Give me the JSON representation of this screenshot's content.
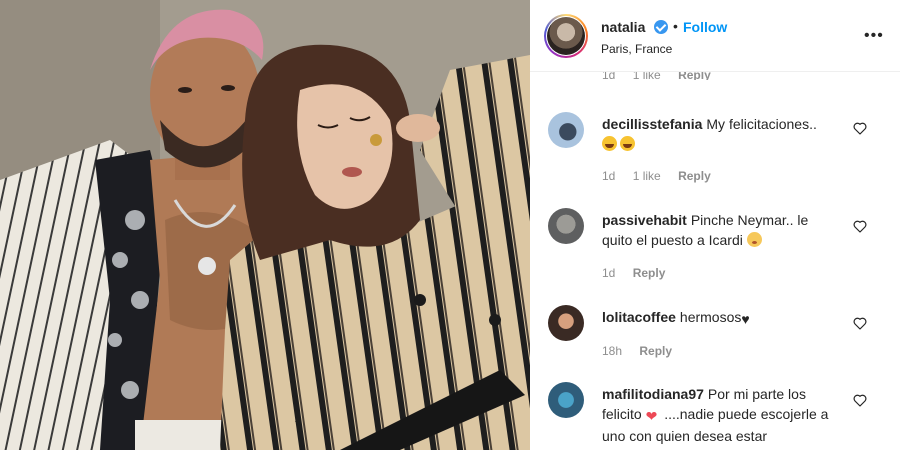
{
  "post": {
    "username": "natalia",
    "follow_label": "Follow",
    "separator": "•",
    "location": "Paris, France",
    "more_label": "•••"
  },
  "comments": {
    "partial_top": {
      "time": "1d",
      "likes": "1 like",
      "reply": "Reply"
    },
    "items": [
      {
        "username": "decillisstefania",
        "text": "My felicitaciones..",
        "emoji": [
          "laughing-crying",
          "laughing-crying"
        ],
        "time": "1d",
        "likes": "1 like",
        "reply": "Reply"
      },
      {
        "username": "passivehabit",
        "text": "Pinche Neymar.. le quito el puesto a Icardi",
        "emoji": [
          "flushed"
        ],
        "time": "1d",
        "reply": "Reply"
      },
      {
        "username": "lolitacoffee",
        "text": "hermosos",
        "emoji": [
          "black-heart"
        ],
        "time": "18h",
        "reply": "Reply"
      },
      {
        "username": "mafilitodiana97",
        "text_before": "Por mi parte los felicito",
        "text_after": " ....nadie puede escojerle a uno con quien desea estar",
        "emoji": [
          "red-heart"
        ]
      }
    ]
  },
  "colors": {
    "follow_blue": "#0095f6",
    "verified_blue": "#3897f0",
    "muted_gray": "#8e8e8e",
    "text_dark": "#262626"
  },
  "icons": [
    "verified-badge-icon",
    "more-options-icon",
    "heart-icon"
  ]
}
